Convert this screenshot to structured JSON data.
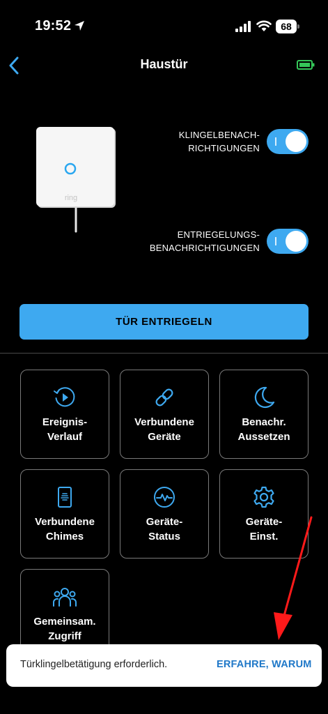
{
  "status_bar": {
    "time": "19:52",
    "battery": "68"
  },
  "header": {
    "title": "Haustür"
  },
  "device": {
    "brand": "ring"
  },
  "toggles": [
    {
      "label": "KLINGELBENACH-\nRICHTIGUNGEN",
      "state": "on"
    },
    {
      "label": "ENTRIEGELUNGS-\nBENACHRICHTIGUNGEN",
      "state": "on"
    }
  ],
  "unlock_button": "TÜR ENTRIEGELN",
  "tiles": [
    {
      "label": "Ereignis-\nVerlauf",
      "icon": "history-play-icon"
    },
    {
      "label": "Verbundene\nGeräte",
      "icon": "link-icon"
    },
    {
      "label": "Benachr.\nAussetzen",
      "icon": "moon-icon"
    },
    {
      "label": "Verbundene\nChimes",
      "icon": "chime-icon"
    },
    {
      "label": "Geräte-\nStatus",
      "icon": "pulse-icon"
    },
    {
      "label": "Geräte-\nEinst.",
      "icon": "gear-icon"
    },
    {
      "label": "Gemeinsam.\nZugriff",
      "icon": "people-icon"
    }
  ],
  "toast": {
    "message": "Türklingelbetätigung erforderlich.",
    "link": "ERFAHRE, WARUM"
  },
  "colors": {
    "accent": "#3ea9f0",
    "icon_blue": "#3ea9f0",
    "link_blue": "#1f78c8",
    "battery_green": "#35c759",
    "arrow_red": "#ff1a1a"
  }
}
